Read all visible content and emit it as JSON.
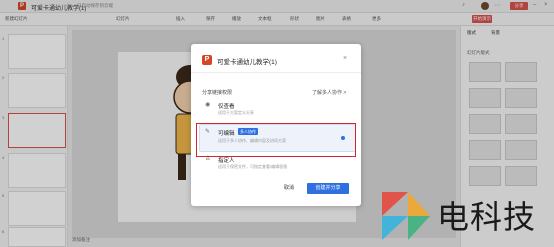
{
  "app": {
    "logo_letter": "P",
    "title": "可爱卡通幼儿教学(1)",
    "saved_status": "已自动保存到云端",
    "present_label": "开始演示",
    "share_label": "分享"
  },
  "toolbar": {
    "items": [
      "新建幻灯片",
      "幻灯片",
      "插入",
      "保存",
      "播放",
      "文本框",
      "形状",
      "图片",
      "表格",
      "更多"
    ]
  },
  "slides_panel": {
    "numbers": [
      "1",
      "2",
      "3",
      "4",
      "5",
      "6"
    ]
  },
  "right_panel": {
    "tabs": [
      "版式",
      "背景"
    ],
    "section": "幻灯片版式"
  },
  "footer": {
    "notes_label": "添加备注"
  },
  "dialog": {
    "logo_letter": "P",
    "title": "可爱卡通幼儿教学(1)",
    "close_symbol": "×",
    "perm_label": "分享链接权限",
    "learn_more": "了解多人协作 >",
    "options": [
      {
        "icon": "eye-icon",
        "title": "仅查看",
        "desc": "适用于方案定义分享"
      },
      {
        "icon": "pencil-icon",
        "title": "可编辑",
        "badge": "多人协作",
        "desc": "适用于多人协作、编辑内容及协同方案"
      },
      {
        "icon": "person-icon",
        "title": "指定人",
        "desc": "适用于保密文件，可指定查看/编辑权限"
      }
    ],
    "selected_index": 1,
    "cancel_label": "取消",
    "create_label": "创建并分享"
  },
  "watermark": {
    "text": "电科技"
  },
  "colors": {
    "brand_red": "#d24726",
    "accent_blue": "#2f6fe0",
    "highlight_red": "#d9232a"
  }
}
